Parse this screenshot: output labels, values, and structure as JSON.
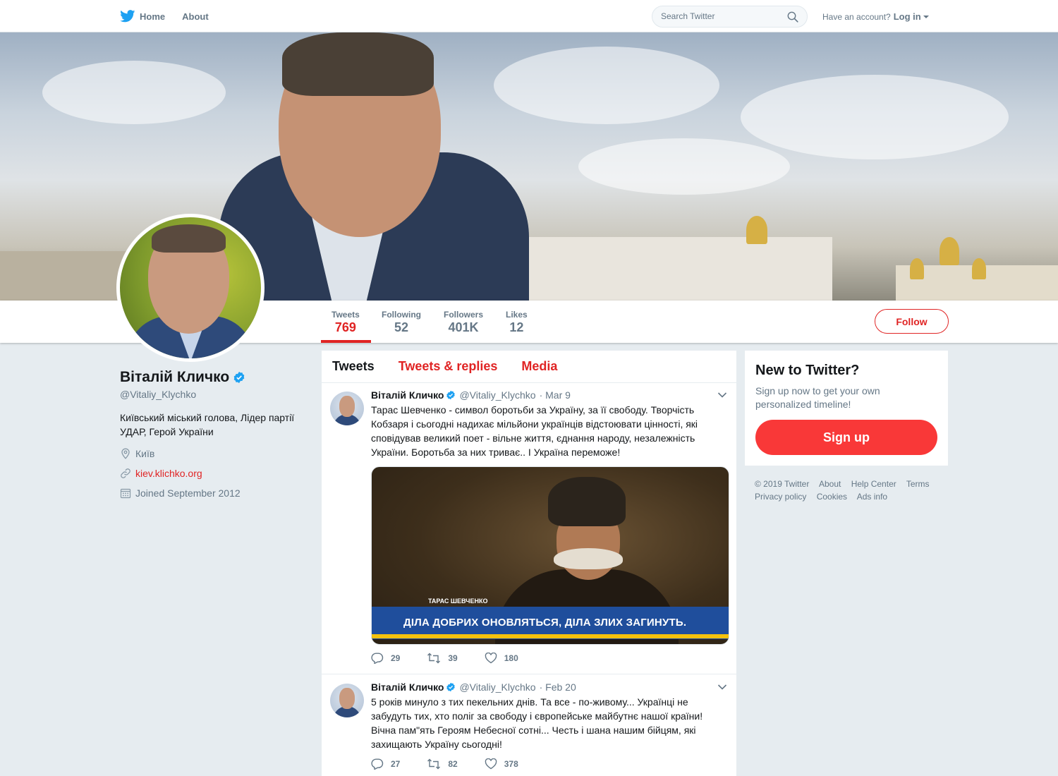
{
  "nav": {
    "home": "Home",
    "about": "About",
    "search_placeholder": "Search Twitter",
    "have_account": "Have an account?",
    "login": "Log in"
  },
  "profile": {
    "name": "Віталій Кличко",
    "handle": "@Vitaliy_Klychko",
    "bio": "Київський міський голова, Лідер партії УДАР, Герой України",
    "location": "Київ",
    "website": "kiev.klichko.org",
    "joined": "Joined September 2012"
  },
  "stats": [
    {
      "label": "Tweets",
      "value": "769"
    },
    {
      "label": "Following",
      "value": "52"
    },
    {
      "label": "Followers",
      "value": "401K"
    },
    {
      "label": "Likes",
      "value": "12"
    }
  ],
  "follow_label": "Follow",
  "timeline_tabs": [
    "Tweets",
    "Tweets & replies",
    "Media"
  ],
  "tweets": [
    {
      "name": "Віталій Кличко",
      "handle": "@Vitaliy_Klychko",
      "date": "· Mar 9",
      "text": "Тарас Шевченко - символ боротьби за Україну, за її свободу. Творчість Кобзаря і сьогодні надихає мільйони українців відстоювати цінності, які сповідував великий поет - вільне життя, єднання народу, незалежність України. Боротьба за них триває.. І Україна переможе!",
      "media_caption": "ТАРАС ШЕВЧЕНКО",
      "media_slogan": "ДІЛА ДОБРИХ ОНОВЛЯТЬСЯ, ДІЛА ЗЛИХ ЗАГИНУТЬ.",
      "replies": "29",
      "retweets": "39",
      "likes": "180"
    },
    {
      "name": "Віталій Кличко",
      "handle": "@Vitaliy_Klychko",
      "date": "· Feb 20",
      "text": "5 років минуло з тих пекельних днів. Та все - по-живому... Українці не забудуть тих, хто поліг за свободу і європейське майбутнє нашої країни! Вічна пам\"ять Героям Небесної сотні... Честь і шана нашим бійцям, які захищають Україну сьогодні!",
      "replies": "27",
      "retweets": "82",
      "likes": "378"
    }
  ],
  "signup": {
    "title": "New to Twitter?",
    "subtitle": "Sign up now to get your own personalized timeline!",
    "button": "Sign up"
  },
  "footer": [
    "© 2019 Twitter",
    "About",
    "Help Center",
    "Terms",
    "Privacy policy",
    "Cookies",
    "Ads info"
  ],
  "colors": {
    "accent": "#e02424",
    "signup_button": "#f93838",
    "verified": "#1da1f2",
    "twitter_blue": "#1da1f2"
  },
  "icons": [
    "twitter-bird-icon",
    "search-icon",
    "verified-badge-icon",
    "location-pin-icon",
    "link-icon",
    "calendar-icon",
    "chevron-down-icon",
    "reply-icon",
    "retweet-icon",
    "like-icon"
  ]
}
